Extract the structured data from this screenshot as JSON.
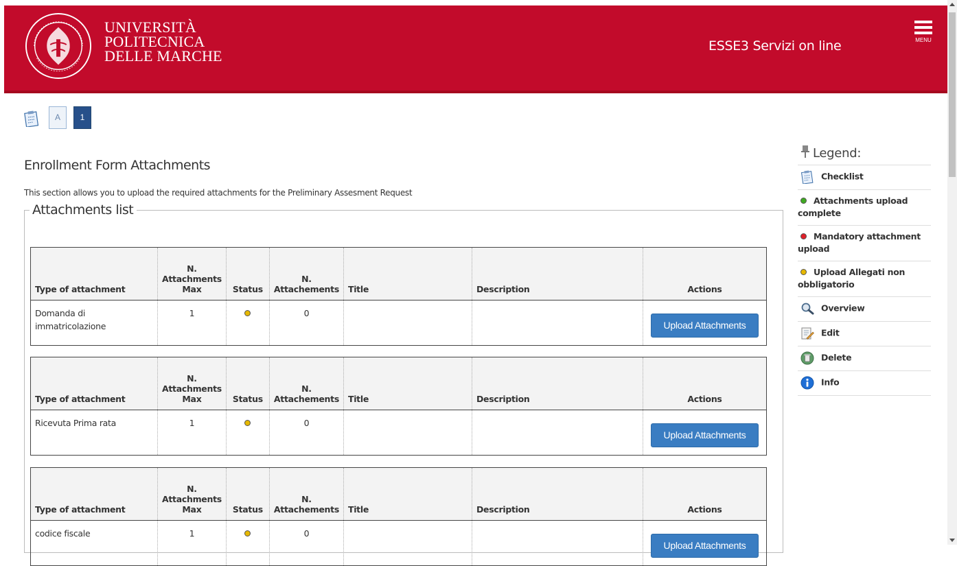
{
  "header": {
    "university_lines": [
      "UNIVERSITÀ",
      "POLITECNICA",
      "DELLE MARCHE"
    ],
    "service_title": "ESSE3 Servizi on line",
    "menu_label": "MENU"
  },
  "steps": [
    "A",
    "1"
  ],
  "page": {
    "title": "Enrollment Form Attachments",
    "intro": "This section allows you to upload the required attachments for the Preliminary Assesment Request",
    "fieldset_legend": "Attachments list"
  },
  "table": {
    "headers": {
      "type": "Type of attachment",
      "max_lines": [
        "N.",
        "Attachments",
        "Max"
      ],
      "status": "Status",
      "count_lines": [
        "N.",
        "Attachements"
      ],
      "title": "Title",
      "description": "Description",
      "actions": "Actions"
    },
    "rows": [
      {
        "type": "Domanda di immatricolazione",
        "max": "1",
        "status": "optional",
        "count": "0",
        "title": "",
        "description": "",
        "action": "Upload Attachments"
      },
      {
        "type": "Ricevuta Prima rata",
        "max": "1",
        "status": "optional",
        "count": "0",
        "title": "",
        "description": "",
        "action": "Upload Attachments"
      },
      {
        "type": "codice fiscale",
        "max": "1",
        "status": "optional",
        "count": "0",
        "title": "",
        "description": "",
        "action": "Upload Attachments"
      }
    ]
  },
  "legend": {
    "title": "Legend:",
    "items": [
      {
        "icon": "checklist-icon",
        "label": "Checklist"
      },
      {
        "icon": "green-dot",
        "label": "Attachments upload complete"
      },
      {
        "icon": "red-dot",
        "label": "Mandatory attachment upload"
      },
      {
        "icon": "yellow-dot",
        "label": "Upload Allegati non obbligatorio"
      },
      {
        "icon": "magnifier-icon",
        "label": "Overview"
      },
      {
        "icon": "edit-icon",
        "label": "Edit"
      },
      {
        "icon": "delete-icon",
        "label": "Delete"
      },
      {
        "icon": "info-icon",
        "label": "Info"
      }
    ]
  },
  "colors": {
    "header_red": "#c20b2b",
    "button_blue": "#3a7dc2",
    "step_active": "#27508a",
    "status_yellow": "#e6b800",
    "status_green": "#3faa22",
    "status_red": "#e0202a"
  }
}
